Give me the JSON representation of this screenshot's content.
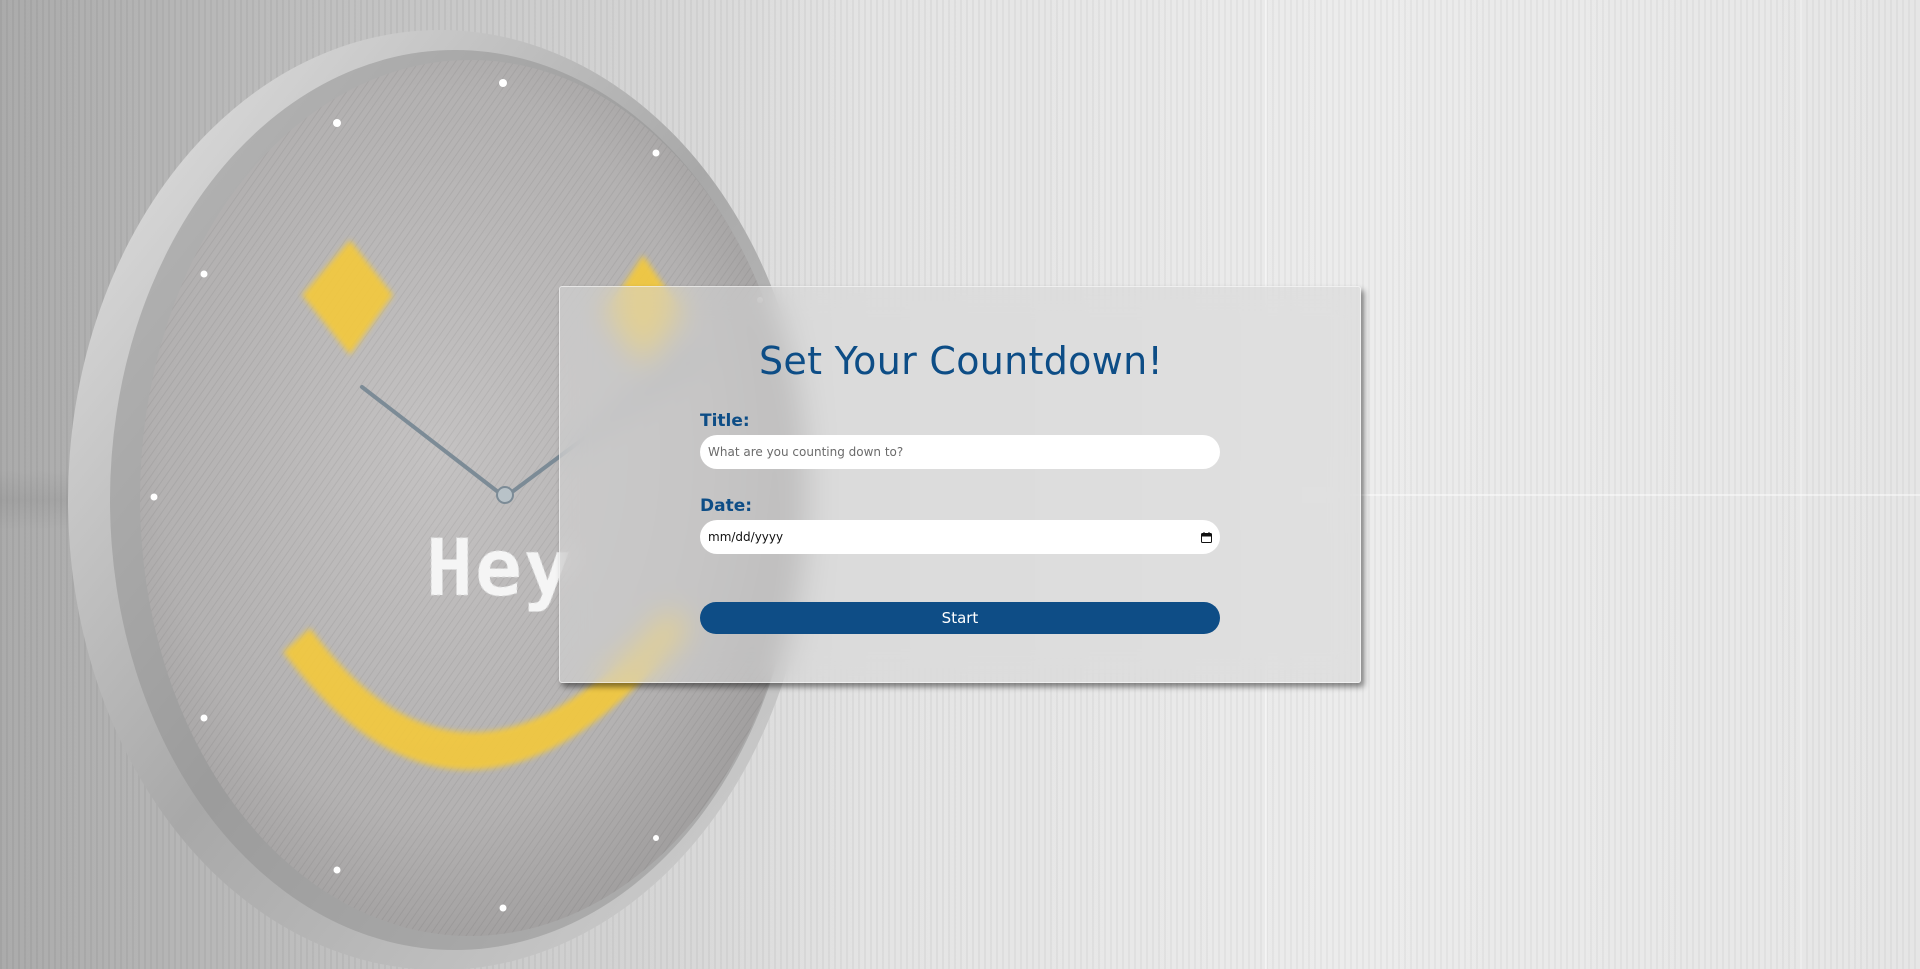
{
  "countdown_form": {
    "heading": "Set Your Countdown!",
    "title_label": "Title:",
    "title_placeholder": "What are you counting down to?",
    "date_label": "Date:",
    "date_value": "mm/dd/yyyy",
    "start_label": "Start"
  },
  "background": {
    "clock_text": "Hey"
  },
  "colors": {
    "accent": "#0e4d86",
    "heading": "#0d4d86",
    "input_bg": "#ffffff",
    "clock_led": "#f4c93a"
  },
  "icons": {
    "date_picker": "calendar-icon"
  }
}
